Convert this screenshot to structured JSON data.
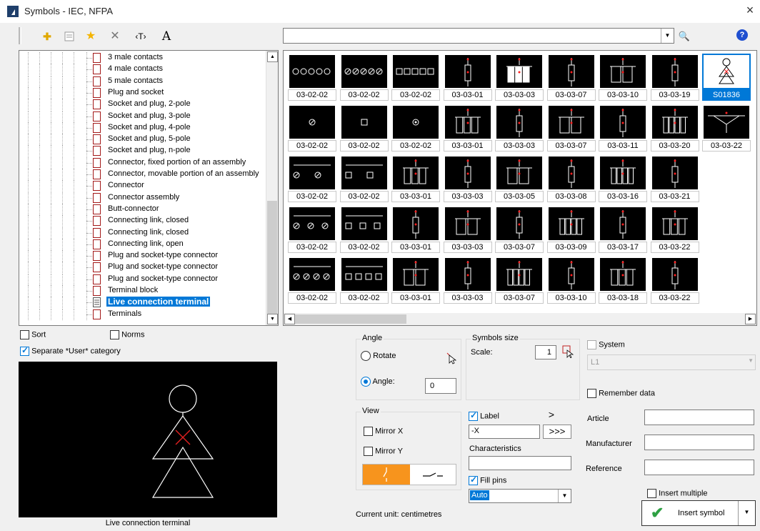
{
  "window": {
    "title": "Symbols - IEC, NFPA",
    "close_glyph": "×"
  },
  "toolbar": {
    "icons": [
      "add-icon",
      "properties-icon",
      "star-icon",
      "delete-icon",
      "text-icon",
      "font-icon"
    ],
    "add_glyph": "✚",
    "star_glyph": "★",
    "delete_glyph": "✕",
    "text_glyph": "‹T›",
    "font_glyph": "A",
    "search_value": "",
    "search_glyph": "🔍",
    "help_label": "?"
  },
  "tree": {
    "items": [
      "3 male contacts",
      "4 male contacts",
      "5 male contacts",
      "Plug and socket",
      "Socket and plug, 2-pole",
      "Socket and plug, 3-pole",
      "Socket and plug, 4-pole",
      "Socket and plug, 5-pole",
      "Socket and plug, n-pole",
      "Connector, fixed portion of an assembly",
      "Connector, movable portion of an assembly",
      "Connector",
      "Connector assembly",
      "Butt-connector",
      "Connecting link, closed",
      "Connecting link, closed",
      "Connecting link, open",
      "Plug and socket-type connector",
      "Plug and socket-type connector",
      "Plug and socket-type connector",
      "Terminal block",
      "Live connection terminal",
      "Terminals"
    ],
    "selected_index": 21
  },
  "gallery": {
    "rows": [
      [
        "03-02-02",
        "03-02-02",
        "03-02-02",
        "03-03-01",
        "03-03-03",
        "03-03-07",
        "03-03-10",
        "03-03-19",
        "S01836"
      ],
      [
        "03-02-02",
        "03-02-02",
        "03-02-02",
        "03-03-01",
        "03-03-03",
        "03-03-07",
        "03-03-11",
        "03-03-20",
        "03-03-22"
      ],
      [
        "03-02-02",
        "03-02-02",
        "03-03-01",
        "03-03-03",
        "03-03-05",
        "03-03-08",
        "03-03-16",
        "03-03-21"
      ],
      [
        "03-02-02",
        "03-02-02",
        "03-03-01",
        "03-03-03",
        "03-03-07",
        "03-03-09",
        "03-03-17",
        "03-03-22"
      ],
      [
        "03-02-02",
        "03-02-02",
        "03-03-01",
        "03-03-03",
        "03-03-07",
        "03-03-10",
        "03-03-18",
        "03-03-22"
      ]
    ],
    "selected": "S01836"
  },
  "options": {
    "sort_label": "Sort",
    "norms_label": "Norms",
    "separate_label": "Separate *User* category",
    "separate_checked": true
  },
  "preview": {
    "caption": "Live connection terminal"
  },
  "angle": {
    "title": "Angle",
    "rotate_label": "Rotate",
    "angle_label": "Angle:",
    "angle_value": "0",
    "mode": "angle"
  },
  "symbols_size": {
    "title": "Symbols size",
    "scale_label": "Scale:",
    "scale_value": "1"
  },
  "view": {
    "title": "View",
    "mirror_x_label": "Mirror X",
    "mirror_y_label": "Mirror Y",
    "active_color": "#f7941d"
  },
  "label": {
    "label_text": "Label",
    "label_checked": true,
    "value": "-X",
    "next_glyph": ">",
    "next_all_glyph": ">>>",
    "characteristics_label": "Characteristics",
    "characteristics_value": "",
    "fill_pins_label": "Fill pins",
    "fill_pins_checked": true,
    "fill_value": "Auto"
  },
  "status": {
    "unit_text": "Current unit: centimetres"
  },
  "right": {
    "system_label": "System",
    "system_value": "L1",
    "remember_label": "Remember data",
    "article_label": "Article",
    "manufacturer_label": "Manufacturer",
    "reference_label": "Reference",
    "insert_multiple_label": "Insert multiple",
    "insert_button_label": "Insert symbol"
  },
  "colors": {
    "accent": "#0078d7",
    "symbol_line": "#ffffff",
    "symbol_mark": "#ff2020"
  }
}
